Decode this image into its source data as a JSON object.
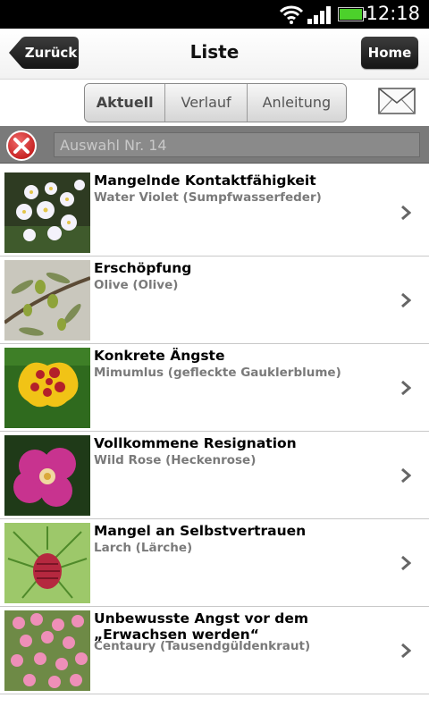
{
  "status_bar": {
    "time": "12:18"
  },
  "header": {
    "back_label": "Zurück",
    "title": "Liste",
    "home_label": "Home"
  },
  "tabs": [
    {
      "label": "Aktuell",
      "active": true
    },
    {
      "label": "Verlauf",
      "active": false
    },
    {
      "label": "Anleitung",
      "active": false
    }
  ],
  "search": {
    "placeholder": "Auswahl Nr. 14"
  },
  "items": [
    {
      "title": "Mangelnde Kontaktfähigkeit",
      "subtitle": "Water Violet (Sumpfwasserfeder)",
      "image": "water-violet"
    },
    {
      "title": "Erschöpfung",
      "subtitle": "Olive (Olive)",
      "image": "olive"
    },
    {
      "title": "Konkrete Ängste",
      "subtitle": "Mimumlus (gefleckte Gauklerblume)",
      "image": "mimulus"
    },
    {
      "title": "Vollkommene Resignation",
      "subtitle": "Wild Rose (Heckenrose)",
      "image": "wild-rose"
    },
    {
      "title": "Mangel an Selbstvertrauen",
      "subtitle": "Larch (Lärche)",
      "image": "larch"
    },
    {
      "title": "Unbewusste Angst vor dem „Erwachsen werden“",
      "subtitle": "Centaury (Tausendgüldenkraut)",
      "image": "centaury"
    }
  ],
  "colors": {
    "accent_red": "#d42a2a",
    "battery_green": "#4cd12b"
  }
}
